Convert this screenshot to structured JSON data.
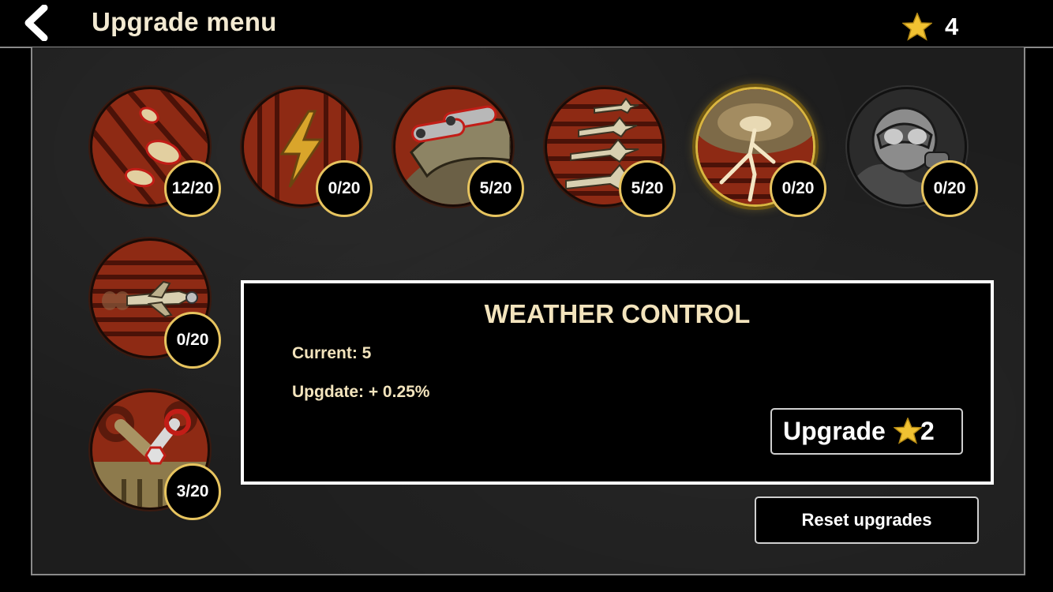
{
  "header": {
    "back_icon": "chevron-left-icon",
    "title": "Upgrade menu",
    "stars": "4"
  },
  "upgrades": [
    {
      "icon": "bullets-icon",
      "progress": "12/20",
      "level": 12,
      "max": 20
    },
    {
      "icon": "lightning-icon",
      "progress": "0/20",
      "level": 0,
      "max": 20
    },
    {
      "icon": "cannons-icon",
      "progress": "5/20",
      "level": 5,
      "max": 20
    },
    {
      "icon": "plane-squadron-icon",
      "progress": "5/20",
      "level": 5,
      "max": 20
    },
    {
      "icon": "weather-storm-icon",
      "progress": "0/20",
      "level": 0,
      "max": 20,
      "selected": true
    },
    {
      "icon": "pilot-helmet-icon",
      "progress": "0/20",
      "level": 0,
      "max": 20,
      "locked": true
    },
    {
      "icon": "fast-plane-icon",
      "progress": "0/20",
      "level": 0,
      "max": 20
    },
    {
      "icon": "wrench-repair-icon",
      "progress": "3/20",
      "level": 3,
      "max": 20
    }
  ],
  "details": {
    "title": "WEATHER CONTROL",
    "current": "Current: 5",
    "update": "Upgdate: + 0.25%",
    "upgrade_label": "Upgrade",
    "upgrade_cost": "2"
  },
  "reset_label": "Reset upgrades",
  "colors": {
    "accent_gold": "#e7c45f",
    "star": "#f1c232",
    "disc_red": "#8e2a14",
    "text_cream": "#f3e4bd"
  }
}
